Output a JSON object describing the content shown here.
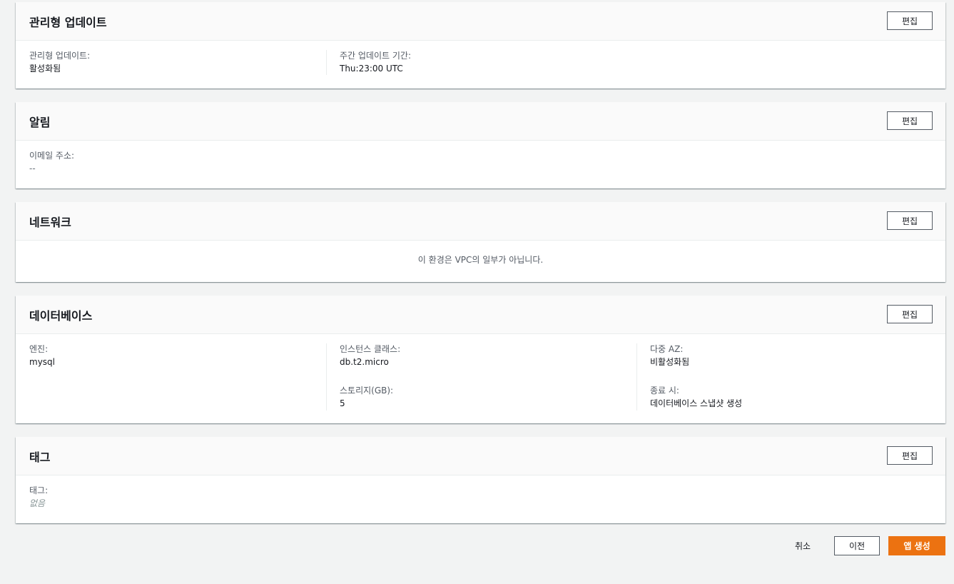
{
  "panels": {
    "managed_updates": {
      "title": "관리형 업데이트",
      "edit_label": "편집",
      "fields": [
        {
          "label": "관리형 업데이트:",
          "value": "활성화됨"
        },
        {
          "label": "주간 업데이트 기간:",
          "value": "Thu:23:00 UTC"
        }
      ]
    },
    "notifications": {
      "title": "알림",
      "edit_label": "편집",
      "fields": [
        {
          "label": "이메일 주소:",
          "value": "--"
        }
      ]
    },
    "network": {
      "title": "네트워크",
      "edit_label": "편집",
      "message": "이 환경은 VPC의 일부가 아닙니다."
    },
    "database": {
      "title": "데이터베이스",
      "edit_label": "편집",
      "fields": [
        {
          "label": "엔진:",
          "value": "mysql"
        },
        {
          "label": "인스턴스 클래스:",
          "value": "db.t2.micro"
        },
        {
          "label": "스토리지(GB):",
          "value": "5"
        },
        {
          "label": "다중 AZ:",
          "value": "비활성화됨"
        },
        {
          "label": "종료 시:",
          "value": "데이터베이스 스냅샷 생성"
        }
      ]
    },
    "tags": {
      "title": "태그",
      "edit_label": "편집",
      "fields": [
        {
          "label": "태그:",
          "value": "없음"
        }
      ]
    }
  },
  "footer": {
    "cancel_label": "취소",
    "previous_label": "이전",
    "create_label": "앱 생성"
  },
  "colors": {
    "primary_button": "#ec7211",
    "background": "#f2f3f3"
  }
}
